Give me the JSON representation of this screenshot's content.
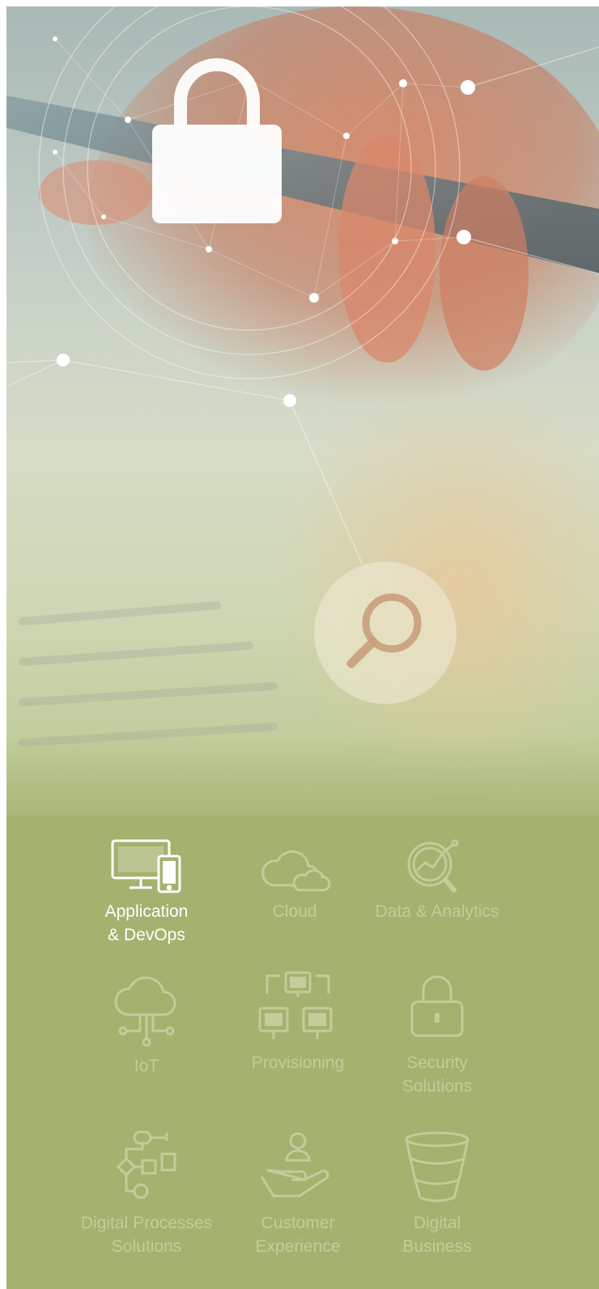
{
  "hero": {
    "lock_icon": "padlock-icon",
    "search_icon": "magnifier-icon"
  },
  "services": [
    {
      "label": "Application\n& DevOps",
      "icon": "devices-icon",
      "active": true
    },
    {
      "label": "Cloud",
      "icon": "cloud-icon",
      "active": false
    },
    {
      "label": "Data & Analytics",
      "icon": "analytics-magnifier-icon",
      "active": false
    },
    {
      "label": "IoT",
      "icon": "cloud-circuit-icon",
      "active": false
    },
    {
      "label": "Provisioning",
      "icon": "network-monitors-icon",
      "active": false
    },
    {
      "label": "Security\nSolutions",
      "icon": "padlock-icon",
      "active": false
    },
    {
      "label": "Digital Processes\nSolutions",
      "icon": "flowchart-icon",
      "active": false
    },
    {
      "label": "Customer\nExperience",
      "icon": "hand-person-icon",
      "active": false
    },
    {
      "label": "Digital\nBusiness",
      "icon": "funnel-icon",
      "active": false
    }
  ],
  "colors": {
    "panel": "#a4b26f",
    "active_label": "#ffffff",
    "inactive_label": "#c3cc9a"
  }
}
